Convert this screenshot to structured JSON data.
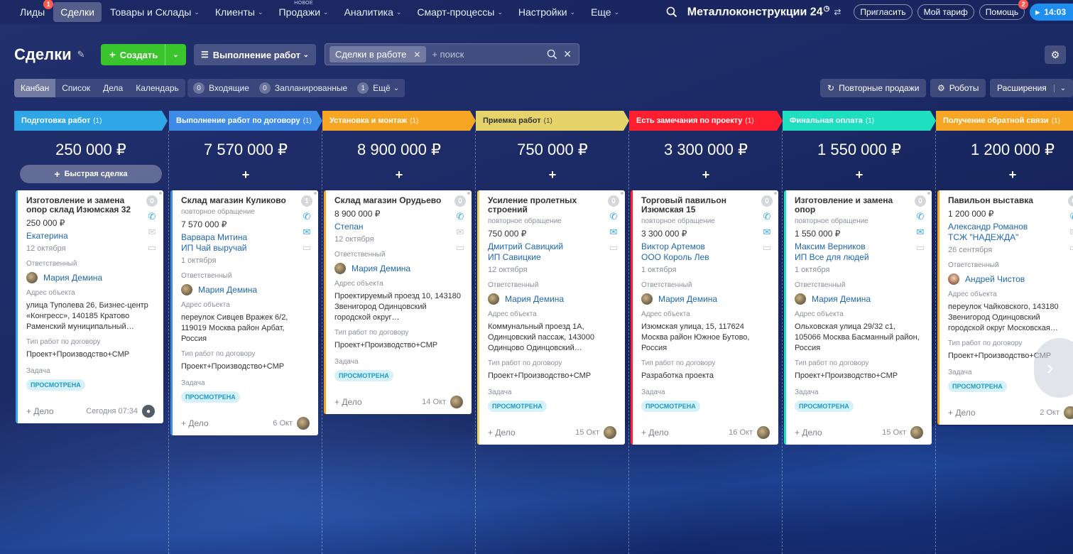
{
  "nav": {
    "items": [
      {
        "label": "Лиды",
        "counter": "1",
        "chev": false
      },
      {
        "label": "Сделки",
        "counter": "",
        "chev": false,
        "active": true
      },
      {
        "label": "Товары и Склады",
        "counter": "",
        "chev": true
      },
      {
        "label": "Клиенты",
        "counter": "",
        "chev": true
      },
      {
        "label": "Продажи",
        "counter": "",
        "chev": true,
        "tag": "НОВОЕ"
      },
      {
        "label": "Аналитика",
        "counter": "",
        "chev": true
      },
      {
        "label": "Смарт-процессы",
        "counter": "",
        "chev": true
      },
      {
        "label": "Настройки",
        "counter": "",
        "chev": true
      },
      {
        "label": "Еще",
        "counter": "",
        "chev": true
      }
    ],
    "company": "Металлоконструкции 24",
    "invite": "Пригласить",
    "tariff": "Мой тариф",
    "help": "Помощь",
    "help_counter": "2",
    "time": "14:03"
  },
  "header": {
    "title": "Сделки",
    "create": "Создать",
    "funnel": "Выполнение работ",
    "filter_tag": "Сделки в работе",
    "search_placeholder": "+ поиск"
  },
  "views": [
    "Канбан",
    "Список",
    "Дела",
    "Календарь"
  ],
  "counters": [
    {
      "num": "0",
      "label": "Входящие"
    },
    {
      "num": "0",
      "label": "Запланированные"
    },
    {
      "num": "1",
      "label": "Ещё"
    }
  ],
  "right_buttons": {
    "repeat": "Повторные продажи",
    "robots": "Роботы",
    "extensions": "Расширения"
  },
  "quick_deal": "Быстрая сделка",
  "labels": {
    "responsible": "Ответственный",
    "address": "Адрес объекта",
    "work_type": "Тип работ по договору",
    "task": "Задача",
    "repeat": "повторное обращение",
    "add_task": "+ Дело"
  },
  "columns": [
    {
      "stage": "Подготовка работ",
      "count": "(1)",
      "color": "#2fa6e6",
      "sum": "250 000 ₽",
      "card": {
        "title": "Изготовление и замена опор склад Изюмская 32",
        "sub": "",
        "amount": "250 000 ₽",
        "client1": "Екатерина",
        "client2": "",
        "date": "12 октября",
        "responsible": "Мария Демина",
        "address": "улица Туполева 26, Бизнес-центр «Конгресс», 140185 Кратово Раменский муниципальный…",
        "work": "Проект+Производство+СМР",
        "badge": "ПРОСМОТРЕНА",
        "when": "Сегодня 07:34",
        "counter": "0",
        "mail_blue": false,
        "accent": "#2fa6e6"
      }
    },
    {
      "stage": "Выполнение работ по договору",
      "count": "(1)",
      "color": "#3f8ce8",
      "sum": "7 570 000 ₽",
      "card": {
        "title": "Склад магазин Куликово",
        "sub": "повторное обращение",
        "amount": "7 570 000 ₽",
        "client1": "Варвара Митина",
        "client2": "ИП Чай выручай",
        "date": "1 октября",
        "responsible": "Мария Демина",
        "address": "переулок Сивцев Вражек 6/2, 119019 Москва район Арбат, Россия",
        "work": "Проект+Производство+СМР",
        "badge": "ПРОСМОТРЕНА",
        "when": "6 Окт",
        "counter": "1",
        "mail_blue": true,
        "accent": "#3f8ce8"
      }
    },
    {
      "stage": "Установка и монтаж",
      "count": "(1)",
      "color": "#f6a623",
      "sum": "8 900 000 ₽",
      "card": {
        "title": "Склад магазин Орудьево",
        "sub": "",
        "amount": "8 900 000 ₽",
        "client1": "Степан",
        "client2": "",
        "date": "12 октября",
        "responsible": "Мария Демина",
        "address": "Проектируемый проезд 10, 143180 Звенигород Одинцовский городской округ…",
        "work": "Проект+Производство+СМР",
        "badge": "ПРОСМОТРЕНА",
        "when": "14 Окт",
        "counter": "0",
        "mail_blue": false,
        "accent": "#f6a623"
      }
    },
    {
      "stage": "Приемка работ",
      "count": "(1)",
      "color": "#e6d46a",
      "sum": "750 000 ₽",
      "card": {
        "title": "Усиление пролетных строений",
        "sub": "повторное обращение",
        "amount": "750 000 ₽",
        "client1": "Дмитрий Савицкий",
        "client2": "ИП Савицкие",
        "date": "12 октября",
        "responsible": "Мария Демина",
        "address": "Коммунальный проезд 1А, Одинцовский пассаж, 143000 Одинцово Одинцовский…",
        "work": "Проект+Производство+СМР",
        "badge": "ПРОСМОТРЕНА",
        "when": "15 Окт",
        "counter": "0",
        "mail_blue": true,
        "accent": "#e6d46a"
      }
    },
    {
      "stage": "Есть замечания по проекту",
      "count": "(1)",
      "color": "#ff1f2f",
      "sum": "3 300 000 ₽",
      "card": {
        "title": "Торговый павильон Изюмская 15",
        "sub": "повторное обращение",
        "amount": "3 300 000 ₽",
        "client1": "Виктор Артемов",
        "client2": "ООО Король Лев",
        "date": "1 октября",
        "responsible": "Мария Демина",
        "address": "Изюмская улица, 15, 117624 Москва район Южное Бутово, Россия",
        "work": "Разработка проекта",
        "badge": "ПРОСМОТРЕНА",
        "when": "16 Окт",
        "counter": "0",
        "mail_blue": true,
        "accent": "#ff1f2f"
      }
    },
    {
      "stage": "Финальная оплата",
      "count": "(1)",
      "color": "#1ee0c1",
      "sum": "1 550 000 ₽",
      "card": {
        "title": "Изготовление и замена опор",
        "sub": "повторное обращение",
        "amount": "1 550 000 ₽",
        "client1": "Максим Верников",
        "client2": "ИП Все для людей",
        "date": "1 октября",
        "responsible": "Мария Демина",
        "address": "Ольховская улица 29/32 с1, 105066 Москва Басманный район, Россия",
        "work": "Проект+Производство+СМР",
        "badge": "ПРОСМОТРЕНА",
        "when": "15 Окт",
        "counter": "0",
        "mail_blue": true,
        "accent": "#1ee0c1"
      }
    },
    {
      "stage": "Получение обратной связи",
      "count": "(1)",
      "color": "#f6a623",
      "sum": "1 200 000 ₽",
      "card": {
        "title": "Павильон выставка",
        "sub": "",
        "amount": "1 200 000 ₽",
        "client1": "Александр Романов",
        "client2": "ТСЖ \"НАДЕЖДА\"",
        "date": "26 сентября",
        "responsible": "Андрей Чистов",
        "address": "переулок Чайковского, 143180 Звенигород Одинцовский городской округ Московская…",
        "work": "Проект+Производство+СМР",
        "badge": "ПРОСМОТРЕНА",
        "when": "2 Окт",
        "counter": "0",
        "mail_blue": false,
        "accent": "#f6a623"
      }
    }
  ]
}
